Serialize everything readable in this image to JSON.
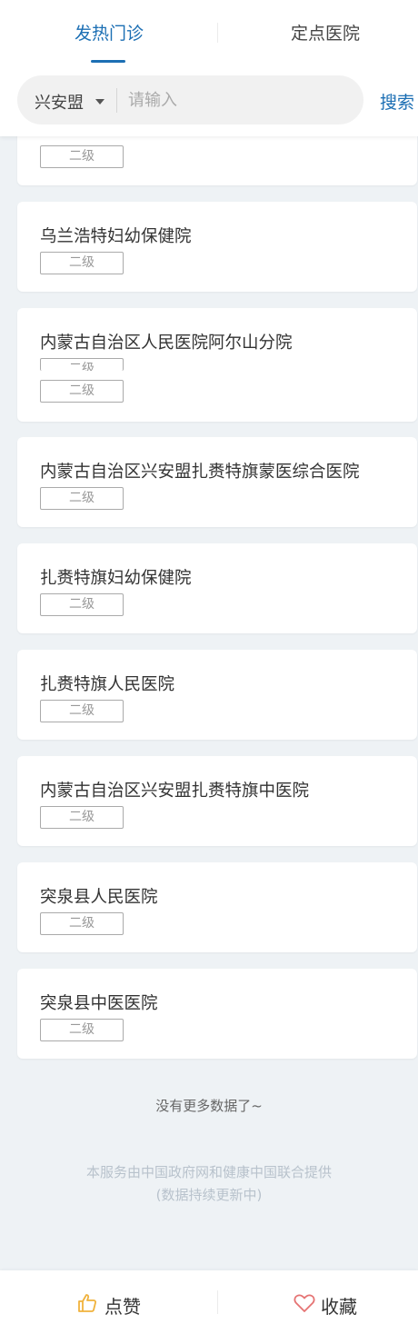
{
  "tabs": [
    {
      "label": "发热门诊",
      "active": true
    },
    {
      "label": "定点医院",
      "active": false
    }
  ],
  "search": {
    "region": "兴安盟",
    "placeholder": "请输入",
    "value": "",
    "button_label": "搜索"
  },
  "hospitals": [
    {
      "name": "",
      "level": "二级"
    },
    {
      "name": "乌兰浩特妇幼保健院",
      "level": "二级"
    },
    {
      "name": "内蒙古自治区人民医院阿尔山分院",
      "level": "二级"
    },
    {
      "name": "内蒙古自治区兴安盟扎赉特旗蒙医综合医院",
      "level": "二级"
    },
    {
      "name": "扎赉特旗妇幼保健院",
      "level": "二级"
    },
    {
      "name": "扎赉特旗人民医院",
      "level": "二级"
    },
    {
      "name": "内蒙古自治区兴安盟扎赉特旗中医院",
      "level": "二级"
    },
    {
      "name": "突泉县人民医院",
      "level": "二级"
    },
    {
      "name": "突泉县中医医院",
      "level": "二级"
    }
  ],
  "duplicate_badge_level": "二级",
  "no_more_text": "没有更多数据了~",
  "service_note": {
    "line1": "本服务由中国政府网和健康中国联合提供",
    "line2": "(数据持续更新中)"
  },
  "footer": {
    "like_label": "点赞",
    "favorite_label": "收藏"
  },
  "colors": {
    "accent": "#1c6fb4",
    "background": "#eef2f5",
    "like_icon": "#f0b23c",
    "favorite_icon": "#e57373"
  },
  "icons": {
    "like": "thumbs-up-icon",
    "favorite": "heart-icon",
    "dropdown": "caret-down-icon"
  }
}
